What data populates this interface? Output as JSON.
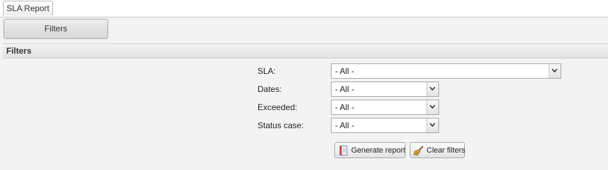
{
  "tabs": [
    {
      "label": "SLA Report",
      "active": true
    }
  ],
  "toolbar": {
    "filters_button": "Filters"
  },
  "panel": {
    "title": "Filters"
  },
  "filters": [
    {
      "label": "SLA:",
      "value": "- All -"
    },
    {
      "label": "Dates:",
      "value": "- All -"
    },
    {
      "label": "Exceeded:",
      "value": "- All -"
    },
    {
      "label": "Status case:",
      "value": "- All -"
    }
  ],
  "actions": {
    "generate_report": "Generate report",
    "clear_filters": "Clear filters"
  },
  "icons": {
    "dropdown": "chevron-down-icon",
    "generate": "report-icon",
    "clear": "broom-icon"
  }
}
